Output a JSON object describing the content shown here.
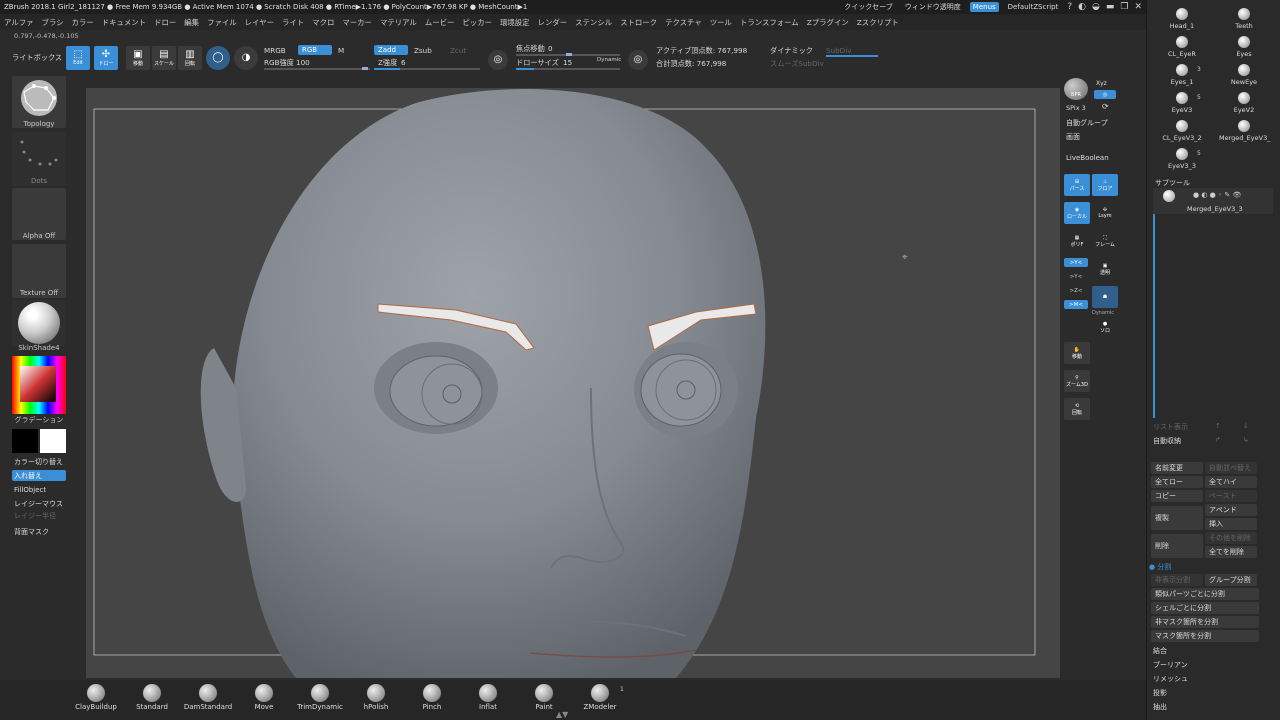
{
  "titlebar": {
    "info": "ZBrush 2018.1   Girl2_181127  ● Free Mem 9.934GB ● Active Mem 1074 ● Scratch Disk 408 ● RTime▶1.176 ● PolyCount▶767.98 KP ● MeshCount▶1",
    "quicksave": "クイックセーブ",
    "window_transparency": "ウィンドウ透明度",
    "menus": "Menus",
    "script": "DefaultZScript",
    "ctrl_icons": [
      "?",
      "◐",
      "◒",
      "▬",
      "❐",
      "✕"
    ]
  },
  "menubar": {
    "items": [
      "アルファ",
      "ブラシ",
      "カラー",
      "ドキュメント",
      "ドロー",
      "編集",
      "ファイル",
      "レイヤー",
      "ライト",
      "マクロ",
      "マーカー",
      "マテリアル",
      "ムービー",
      "ピッカー",
      "環境設定",
      "レンダー",
      "ステンシル",
      "ストローク",
      "テクスチャ",
      "ツール",
      "トランスフォーム",
      "Zプラグイン",
      "Zスクリプト"
    ]
  },
  "coords": "0.797,-0.478,-0.105",
  "topshelf": {
    "lightbox": "ライトボックス",
    "edit": "Edit",
    "draw": "ドロー",
    "move": "移動",
    "scale": "スケール",
    "rotate": "回転",
    "mrgb": "MRGB",
    "rgb": "RGB",
    "m": "M",
    "rgb_intensity_label": "RGB強度",
    "rgb_intensity_value": "100",
    "zadd": "Zadd",
    "zsub": "Zsub",
    "zcut": "Zcut",
    "z_intensity_label": "Z強度",
    "z_intensity_value": "6",
    "focal_shift_label": "焦点移動",
    "focal_shift_value": "0",
    "draw_size_label": "ドローサイズ",
    "draw_size_value": "15",
    "dynamic": "Dynamic",
    "active_points": "アクティブ頂点数: 767,998",
    "total_points": "合計頂点数: 767,998",
    "dynamic_label": "ダイナミック",
    "subdiv": "SubDiv",
    "smooth_subdiv": "スムーズSubDiv"
  },
  "leftpanel": {
    "topology": "Topology",
    "dots": "Dots",
    "alpha": "Alpha Off",
    "texture": "Texture Off",
    "material": "SkinShade4",
    "gradient": "グラデーション",
    "switch_color": "カラー切り替え",
    "swap": "入れ替え",
    "fill_object": "FillObject",
    "layer_mouse": "レイジーマウス",
    "layer_radius": "レイジー半径",
    "backface_mask": "背面マスク"
  },
  "rightstrip": {
    "bpr": "BPR",
    "xyz": "Xyz",
    "spix": "SPix 3",
    "auto_group": "自動グループ",
    "screen": "画面",
    "live_boolean": "LiveBoolean",
    "perspective": "パース",
    "floor": "フロア",
    "local": "ローカル",
    "lsym": "Lsym",
    "polyf": "ポリF",
    "frame": "フレーム",
    "gx": ">Y<",
    "gy": ">Y<",
    "gz": ">Z<",
    "transp": "透明",
    "mz": ">M<",
    "ghost": "ゴースト",
    "dynamic": "Dynamic",
    "solo": "ソロ",
    "move": "移動",
    "zoom3d": "ズーム3D",
    "rotate": "回転"
  },
  "subpanel": {
    "top_thumbs": [
      {
        "name": "Head_1",
        "count": ""
      },
      {
        "name": "Teeth",
        "count": ""
      },
      {
        "name": "CL_EyeR",
        "count": ""
      },
      {
        "name": "Eyes",
        "count": ""
      },
      {
        "name": "Eyes_1",
        "count": "3"
      },
      {
        "name": "NewEye",
        "count": ""
      },
      {
        "name": "EyeV3",
        "count": "5"
      },
      {
        "name": "EyeV2",
        "count": ""
      },
      {
        "name": "CL_EyeV3_2",
        "count": ""
      },
      {
        "name": "Merged_EyeV3_",
        "count": ""
      },
      {
        "name": "EyeV3_3",
        "count": "5"
      }
    ],
    "subtool_label": "サブツール",
    "subtool_item": "Merged_EyeV3_3",
    "list_all": "リスト表示",
    "auto_collapse": "自動収納",
    "rename": "名前変更",
    "auto_reorder": "自動並べ替え",
    "all_low": "全てロー",
    "all_high": "全てハイ",
    "copy": "コピー",
    "paste": "ペースト",
    "append": "アペンド",
    "duplicate": "複製",
    "insert": "挿入",
    "delete": "削除",
    "delete_other": "その他を削除",
    "delete_all": "全てを削除",
    "split": "分割",
    "split_hidden": "非表示分割",
    "groups_split": "グループ分割",
    "split_similar": "類似パーツごとに分割",
    "split_shell": "シェルごとに分割",
    "split_unmasked": "非マスク箇所を分割",
    "split_masked": "マスク箇所を分割",
    "merge": "結合",
    "boolean": "ブーリアン",
    "remesh": "リメッシュ",
    "project": "投影",
    "extract": "抽出"
  },
  "brushes": [
    {
      "name": "ClayBuildup"
    },
    {
      "name": "Standard"
    },
    {
      "name": "DamStandard"
    },
    {
      "name": "Move"
    },
    {
      "name": "TrimDynamic"
    },
    {
      "name": "hPolish"
    },
    {
      "name": "Pinch"
    },
    {
      "name": "Inflat"
    },
    {
      "name": "Paint"
    },
    {
      "name": "ZModeler"
    }
  ],
  "zmodeler_count": "1",
  "colors": {
    "accent": "#3a8fd6",
    "bg": "#2b2b2b",
    "viewport": "#454545",
    "skin": "#8a8f96"
  }
}
